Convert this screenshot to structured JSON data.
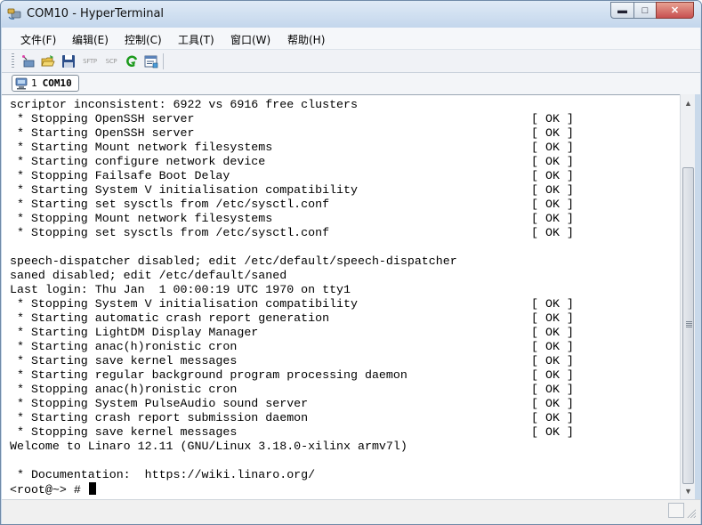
{
  "window": {
    "title": "COM10 - HyperTerminal",
    "icons": {
      "app": "hyperterminal-phone-icon",
      "minimize": "minimize-icon",
      "maximize": "maximize-icon",
      "close": "close-icon"
    }
  },
  "menu": [
    "文件(F)",
    "编辑(E)",
    "控制(C)",
    "工具(T)",
    "窗口(W)",
    "帮助(H)"
  ],
  "toolbar": {
    "buttons": [
      {
        "name": "new-connection",
        "icon": "new-connection-icon"
      },
      {
        "name": "open",
        "icon": "open-folder-icon"
      },
      {
        "name": "save",
        "icon": "save-disk-icon"
      },
      {
        "name": "sftp",
        "label": "SFTP"
      },
      {
        "name": "scp",
        "label": "SCP"
      },
      {
        "name": "reconnect",
        "icon": "green-arrow-icon"
      },
      {
        "name": "properties",
        "icon": "properties-icon"
      }
    ]
  },
  "session_tab": {
    "number": "1",
    "name": "COM10",
    "icon": "computer-icon"
  },
  "terminal": {
    "lines": [
      {
        "text": "scriptor inconsistent: 6922 vs 6916 free clusters"
      },
      {
        "text": " * Stopping OpenSSH server",
        "status": "[ OK ]"
      },
      {
        "text": " * Starting OpenSSH server",
        "status": "[ OK ]"
      },
      {
        "text": " * Starting Mount network filesystems",
        "status": "[ OK ]"
      },
      {
        "text": " * Starting configure network device",
        "status": "[ OK ]"
      },
      {
        "text": " * Stopping Failsafe Boot Delay",
        "status": "[ OK ]"
      },
      {
        "text": " * Starting System V initialisation compatibility",
        "status": "[ OK ]"
      },
      {
        "text": " * Starting set sysctls from /etc/sysctl.conf",
        "status": "[ OK ]"
      },
      {
        "text": " * Stopping Mount network filesystems",
        "status": "[ OK ]"
      },
      {
        "text": " * Stopping set sysctls from /etc/sysctl.conf",
        "status": "[ OK ]"
      },
      {
        "text": ""
      },
      {
        "text": "speech-dispatcher disabled; edit /etc/default/speech-dispatcher"
      },
      {
        "text": "saned disabled; edit /etc/default/saned"
      },
      {
        "text": "Last login: Thu Jan  1 00:00:19 UTC 1970 on tty1"
      },
      {
        "text": " * Stopping System V initialisation compatibility",
        "status": "[ OK ]"
      },
      {
        "text": " * Starting automatic crash report generation",
        "status": "[ OK ]"
      },
      {
        "text": " * Starting LightDM Display Manager",
        "status": "[ OK ]"
      },
      {
        "text": " * Starting anac(h)ronistic cron",
        "status": "[ OK ]"
      },
      {
        "text": " * Starting save kernel messages",
        "status": "[ OK ]"
      },
      {
        "text": " * Starting regular background program processing daemon",
        "status": "[ OK ]"
      },
      {
        "text": " * Stopping anac(h)ronistic cron",
        "status": "[ OK ]"
      },
      {
        "text": " * Stopping System PulseAudio sound server",
        "status": "[ OK ]"
      },
      {
        "text": " * Starting crash report submission daemon",
        "status": "[ OK ]"
      },
      {
        "text": " * Stopping save kernel messages",
        "status": "[ OK ]"
      },
      {
        "text": "Welcome to Linaro 12.11 (GNU/Linux 3.18.0-xilinx armv7l)"
      },
      {
        "text": ""
      },
      {
        "text": " * Documentation:  https://wiki.linaro.org/"
      }
    ],
    "prompt": "<root@~> # "
  },
  "scrollbar": {
    "up_icon": "scroll-up-arrow-icon",
    "down_icon": "scroll-down-arrow-icon"
  }
}
